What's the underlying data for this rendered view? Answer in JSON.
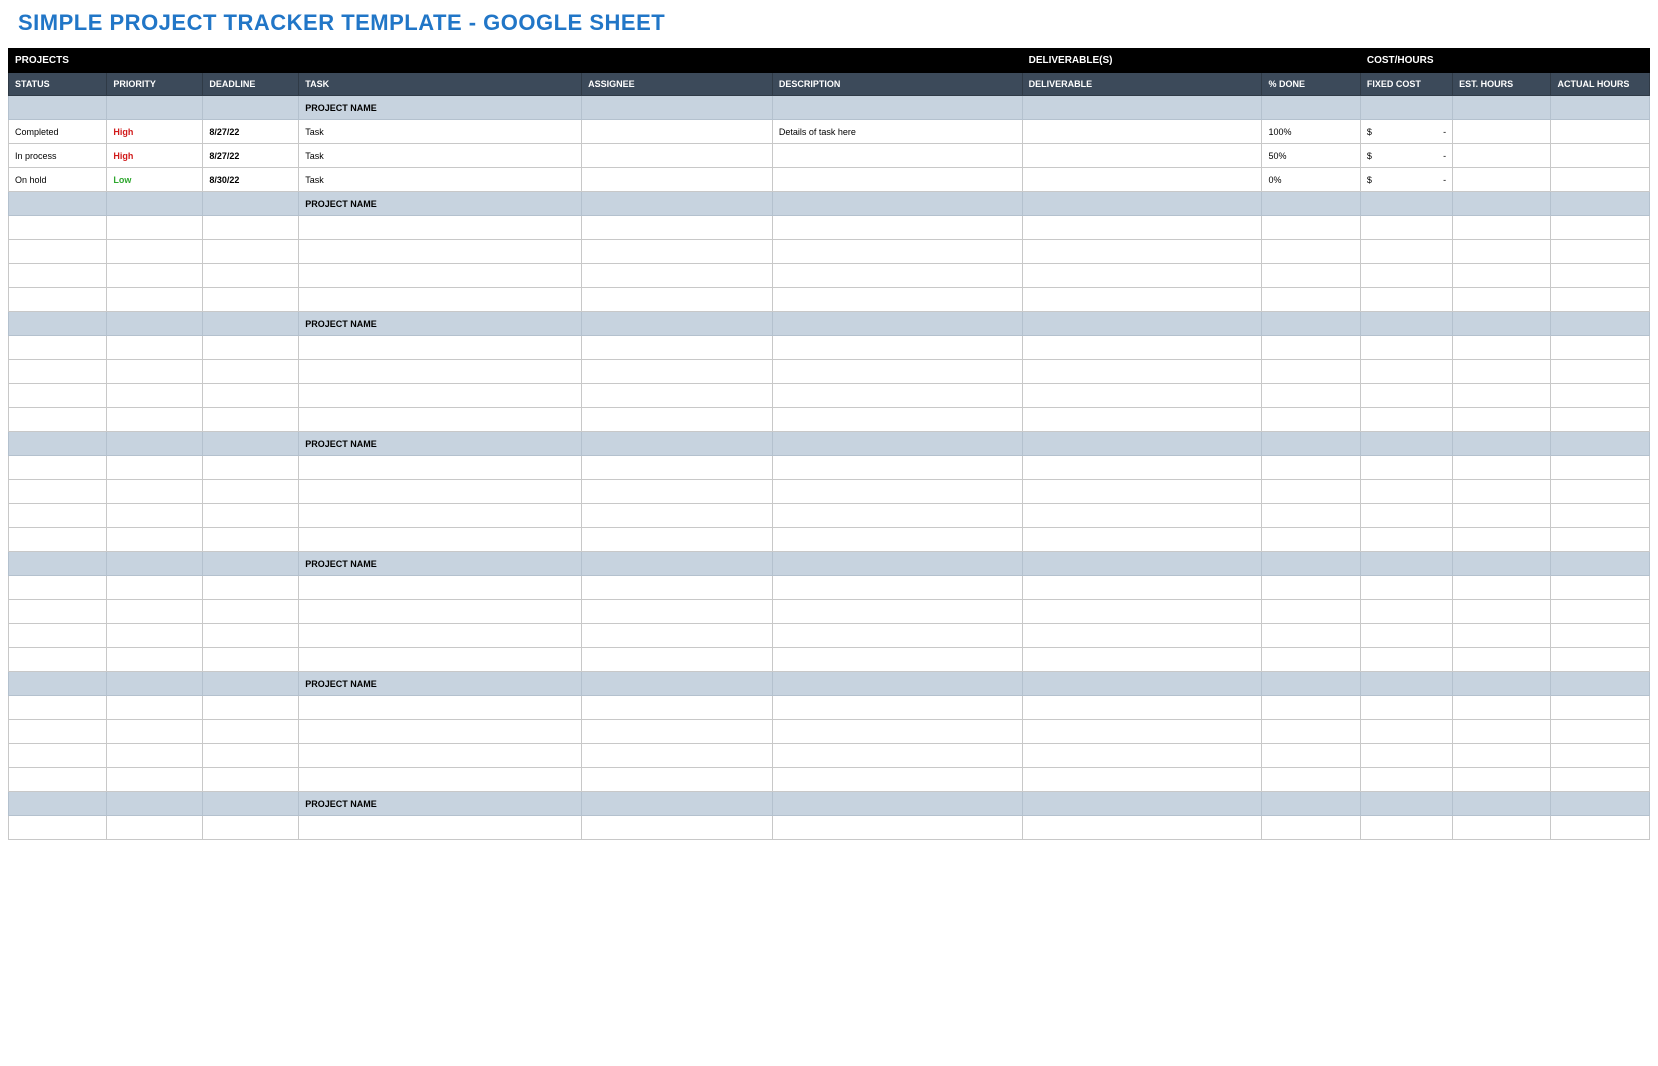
{
  "title": "SIMPLE PROJECT TRACKER TEMPLATE - GOOGLE SHEET",
  "section_headers": {
    "projects": "PROJECTS",
    "deliverables": "DELIVERABLE(S)",
    "cost_hours": "COST/HOURS"
  },
  "columns": {
    "status": "STATUS",
    "priority": "PRIORITY",
    "deadline": "DEADLINE",
    "task": "TASK",
    "assignee": "ASSIGNEE",
    "description": "DESCRIPTION",
    "deliverable": "DELIVERABLE",
    "pct_done": "% DONE",
    "fixed_cost": "FIXED COST",
    "est_hours": "EST. HOURS",
    "actual_hours": "ACTUAL HOURS"
  },
  "groups": [
    {
      "name": "PROJECT NAME",
      "rows": [
        {
          "status": "Completed",
          "priority": "High",
          "priority_class": "pri-high",
          "deadline": "8/27/22",
          "task": "Task",
          "assignee": "",
          "description": "Details of task here",
          "deliverable": "",
          "pct_done": "100%",
          "fixed_cost_sym": "$",
          "fixed_cost_val": "-",
          "est_hours": "",
          "actual_hours": ""
        },
        {
          "status": "In process",
          "priority": "High",
          "priority_class": "pri-high",
          "deadline": "8/27/22",
          "task": "Task",
          "assignee": "",
          "description": "",
          "deliverable": "",
          "pct_done": "50%",
          "fixed_cost_sym": "$",
          "fixed_cost_val": "-",
          "est_hours": "",
          "actual_hours": ""
        },
        {
          "status": "On hold",
          "priority": "Low",
          "priority_class": "pri-low",
          "deadline": "8/30/22",
          "task": "Task",
          "assignee": "",
          "description": "",
          "deliverable": "",
          "pct_done": "0%",
          "fixed_cost_sym": "$",
          "fixed_cost_val": "-",
          "est_hours": "",
          "actual_hours": ""
        }
      ]
    },
    {
      "name": "PROJECT NAME",
      "rows": [
        {},
        {},
        {},
        {}
      ]
    },
    {
      "name": "PROJECT NAME",
      "rows": [
        {},
        {},
        {},
        {}
      ]
    },
    {
      "name": "PROJECT NAME",
      "rows": [
        {},
        {},
        {},
        {}
      ]
    },
    {
      "name": "PROJECT NAME",
      "rows": [
        {},
        {},
        {},
        {}
      ]
    },
    {
      "name": "PROJECT NAME",
      "rows": [
        {},
        {},
        {},
        {}
      ]
    },
    {
      "name": "PROJECT NAME",
      "rows": [
        {}
      ]
    }
  ]
}
